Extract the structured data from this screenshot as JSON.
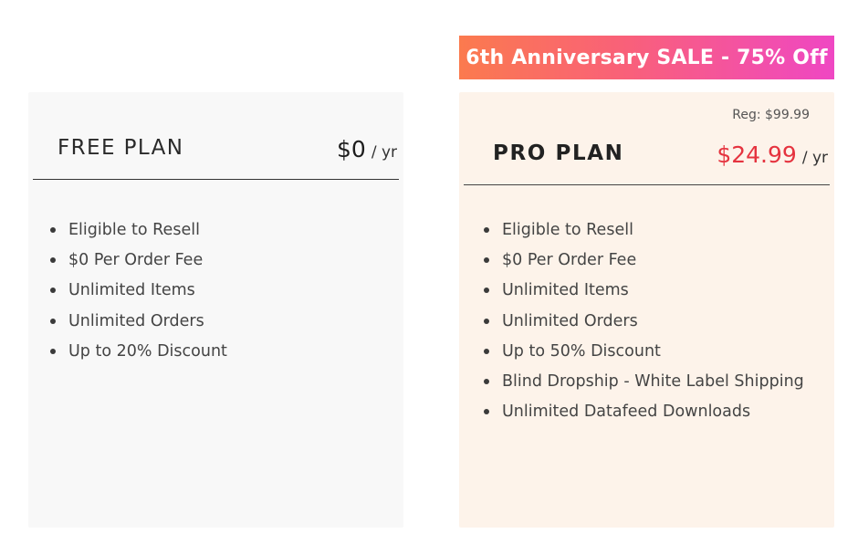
{
  "sale_banner": {
    "text": "6th Anniversary SALE - 75% Off",
    "gradient_colors": [
      "#fb7a4e",
      "#f9607a",
      "#ef47c3"
    ]
  },
  "plans": [
    {
      "name": "FREE PLAN",
      "price": "$0",
      "period": "/ yr",
      "background": "#f8f8f8",
      "features": [
        "Eligible to Resell",
        "$0 Per Order Fee",
        "Unlimited Items",
        "Unlimited Orders",
        "Up to 20% Discount"
      ]
    },
    {
      "name": "PRO PLAN",
      "regular_price": "Reg: $99.99",
      "price": "$24.99",
      "period": "/ yr",
      "price_color": "#e5333f",
      "background": "#fdf3ea",
      "features": [
        "Eligible to Resell",
        "$0 Per Order Fee",
        "Unlimited Items",
        "Unlimited Orders",
        "Up to 50% Discount",
        "Blind Dropship - White Label Shipping",
        "Unlimited Datafeed Downloads"
      ]
    }
  ]
}
